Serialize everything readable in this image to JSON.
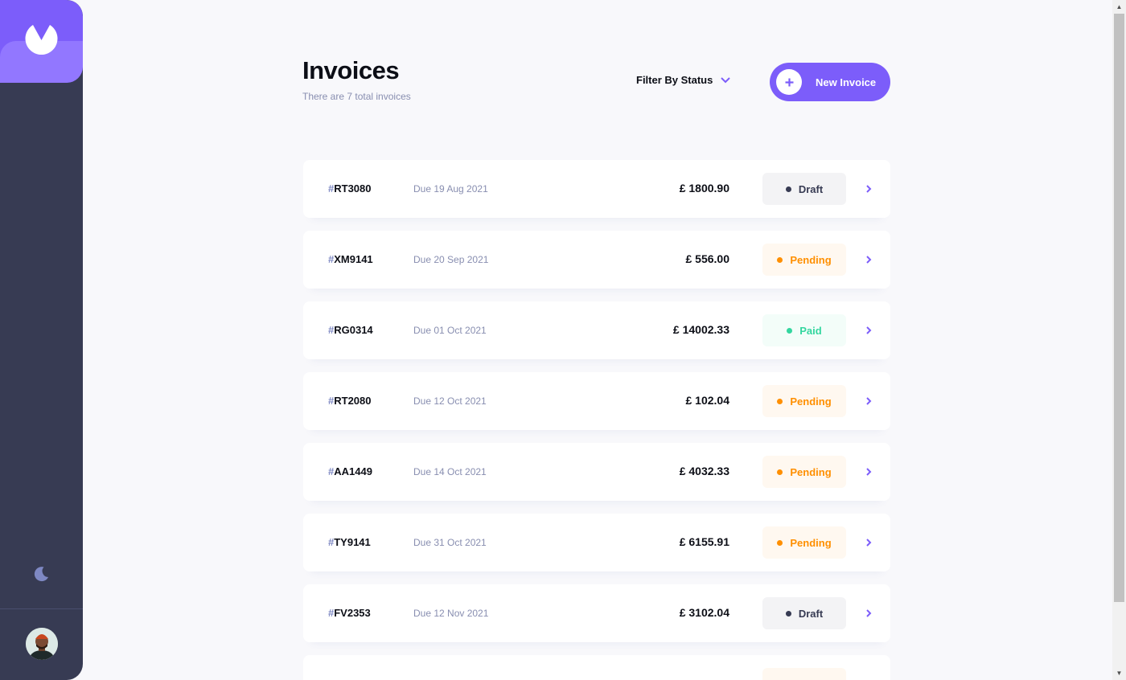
{
  "header": {
    "title": "Invoices",
    "subtitle": "There are 7 total invoices",
    "filter_label": "Filter By Status",
    "new_invoice_label": "New Invoice"
  },
  "colors": {
    "accent": "#7C5DFA",
    "sidebar": "#373B53",
    "draft": "#373B53",
    "pending": "#FF8F00",
    "paid": "#33D69F"
  },
  "sidebar": {
    "logo_icon": "logo-icon",
    "theme_toggle_icon": "moon-icon",
    "avatar": "user-avatar"
  },
  "invoices": [
    {
      "hash": "#",
      "id": "RT3080",
      "due": "Due 19 Aug 2021",
      "amount": "£ 1800.90",
      "status": "Draft",
      "status_key": "draft"
    },
    {
      "hash": "#",
      "id": "XM9141",
      "due": "Due 20 Sep 2021",
      "amount": "£ 556.00",
      "status": "Pending",
      "status_key": "pending"
    },
    {
      "hash": "#",
      "id": "RG0314",
      "due": "Due 01 Oct 2021",
      "amount": "£ 14002.33",
      "status": "Paid",
      "status_key": "paid"
    },
    {
      "hash": "#",
      "id": "RT2080",
      "due": "Due 12 Oct 2021",
      "amount": "£ 102.04",
      "status": "Pending",
      "status_key": "pending"
    },
    {
      "hash": "#",
      "id": "AA1449",
      "due": "Due 14 Oct 2021",
      "amount": "£ 4032.33",
      "status": "Pending",
      "status_key": "pending"
    },
    {
      "hash": "#",
      "id": "TY9141",
      "due": "Due 31 Oct 2021",
      "amount": "£ 6155.91",
      "status": "Pending",
      "status_key": "pending"
    },
    {
      "hash": "#",
      "id": "FV2353",
      "due": "Due 12 Nov 2021",
      "amount": "£ 3102.04",
      "status": "Draft",
      "status_key": "draft"
    },
    {
      "hash": "#",
      "id": "",
      "due": "",
      "amount": "",
      "status": "",
      "status_key": "pending"
    }
  ]
}
